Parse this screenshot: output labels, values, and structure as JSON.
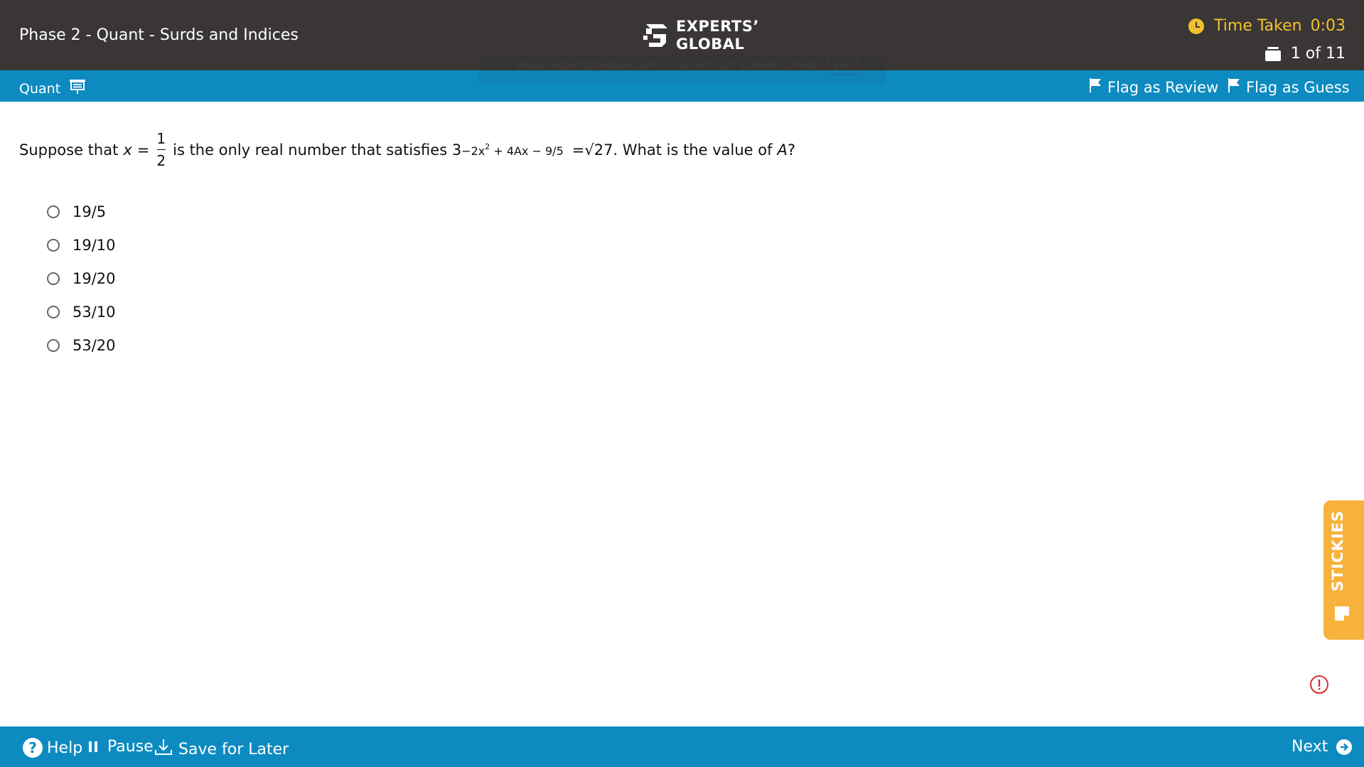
{
  "header": {
    "title": "Phase 2 - Quant - Surds and Indices",
    "logo_line1": "EXPERTS’",
    "logo_line2": "GLOBAL",
    "fullscreen_hint": "www.expertsglobal.com – To exit full screen, press",
    "fullscreen_key": "Esc",
    "time_label": "Time Taken",
    "time_value": "0:03",
    "question_counter": "1 of 11"
  },
  "section_bar": {
    "section_label": "Quant",
    "flag_review_label": "Flag as Review",
    "flag_guess_label": "Flag as Guess"
  },
  "question": {
    "prefix": "Suppose that",
    "variable": "x",
    "equals": "=",
    "frac_num": "1",
    "frac_den": "2",
    "middle": "is the only real number that satisfies 3",
    "exponent": "−2x",
    "exponent_sq": "2",
    "exponent_rest": " + 4Ax − 9/5",
    "suffix": "=√27. What is the value of",
    "target_var": "A",
    "end": "?"
  },
  "options": [
    {
      "label": "19/5"
    },
    {
      "label": "19/10"
    },
    {
      "label": "19/20"
    },
    {
      "label": "53/10"
    },
    {
      "label": "53/20"
    }
  ],
  "sidebar": {
    "stickies_label": "STICKIES"
  },
  "footer": {
    "help_label": "Help",
    "pause_label": "Pause",
    "save_label": "Save for Later",
    "next_label": "Next"
  },
  "colors": {
    "header_bg": "#3a3636",
    "accent_blue": "#0d8bc1",
    "timer_yellow": "#f2c12e",
    "stickies_orange": "#f7b23b",
    "alert_red": "#d62f2f"
  }
}
